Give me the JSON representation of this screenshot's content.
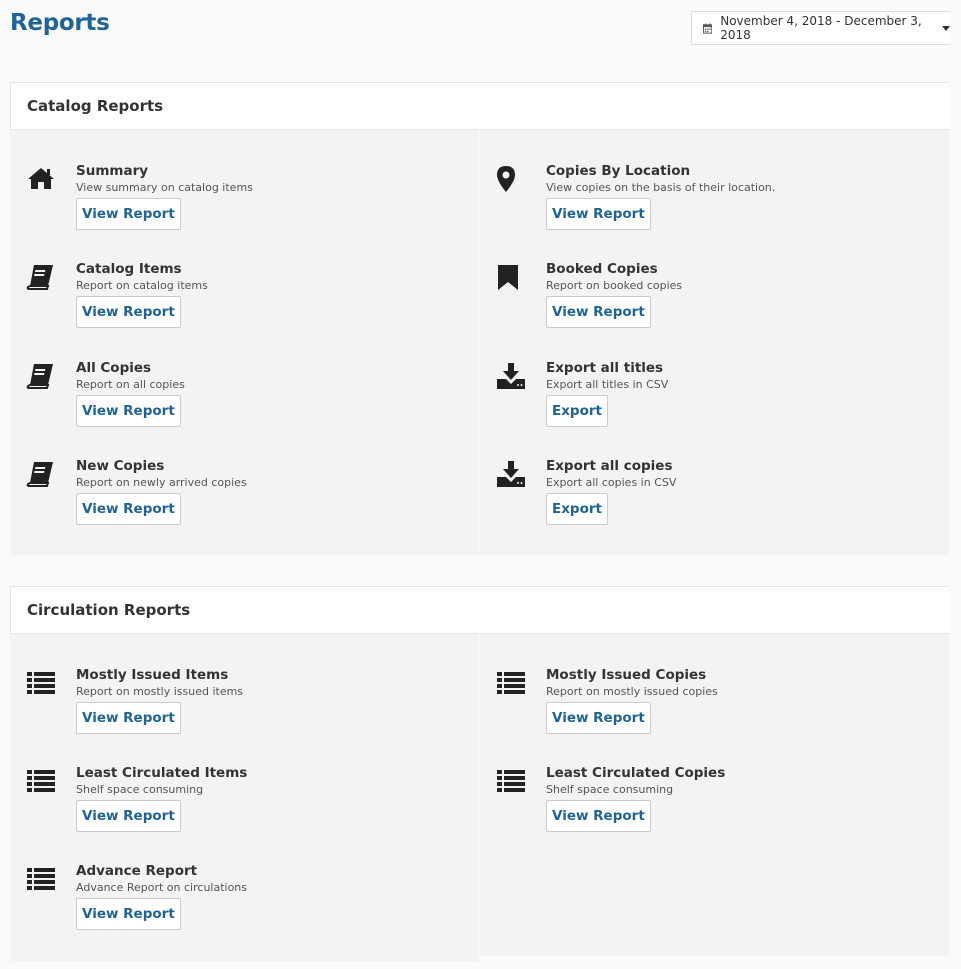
{
  "page": {
    "title": "Reports"
  },
  "date_range": {
    "label": "November 4, 2018 - December 3, 2018",
    "icon": "calendar-icon"
  },
  "catalog": {
    "title": "Catalog Reports",
    "left": [
      {
        "icon": "home-icon",
        "title": "Summary",
        "desc": "View summary on catalog items",
        "button": "View Report"
      },
      {
        "icon": "book-icon",
        "title": "Catalog Items",
        "desc": "Report on catalog items",
        "button": "View Report"
      },
      {
        "icon": "book-icon",
        "title": "All Copies",
        "desc": "Report on all copies",
        "button": "View Report"
      },
      {
        "icon": "book-icon",
        "title": "New Copies",
        "desc": "Report on newly arrived copies",
        "button": "View Report"
      }
    ],
    "right": [
      {
        "icon": "map-marker-icon",
        "title": "Copies By Location",
        "desc": "View copies on the basis of their location.",
        "button": "View Report"
      },
      {
        "icon": "bookmark-icon",
        "title": "Booked Copies",
        "desc": "Report on booked copies",
        "button": "View Report"
      },
      {
        "icon": "download-icon",
        "title": "Export all titles",
        "desc": "Export all titles in CSV",
        "button": "Export"
      },
      {
        "icon": "download-icon",
        "title": "Export all copies",
        "desc": "Export all copies in CSV",
        "button": "Export"
      }
    ]
  },
  "circulation": {
    "title": "Circulation Reports",
    "left": [
      {
        "icon": "list-icon",
        "title": "Mostly Issued Items",
        "desc": "Report on mostly issued items",
        "button": "View Report"
      },
      {
        "icon": "list-icon",
        "title": "Least Circulated Items",
        "desc": "Shelf space consuming",
        "button": "View Report"
      },
      {
        "icon": "list-icon",
        "title": "Advance Report",
        "desc": "Advance Report on circulations",
        "button": "View Report"
      }
    ],
    "right": [
      {
        "icon": "list-icon",
        "title": "Mostly Issued Copies",
        "desc": "Report on mostly issued copies",
        "button": "View Report"
      },
      {
        "icon": "list-icon",
        "title": "Least Circulated Copies",
        "desc": "Shelf space consuming",
        "button": "View Report"
      }
    ]
  },
  "colors": {
    "accent": "#1f6498",
    "icon": "#222222",
    "panel_bg": "#f3f3f3"
  }
}
